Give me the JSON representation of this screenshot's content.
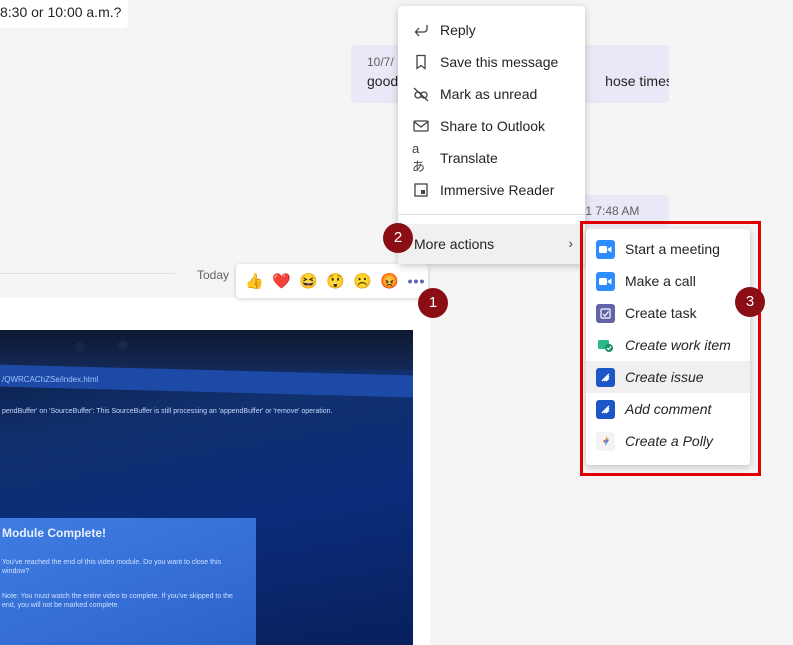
{
  "chat": {
    "prev_message_text": "8:30 or 10:00 a.m.?",
    "own_message": {
      "timestamp": "10/7/",
      "text": "good",
      "text_tail": "hose times."
    },
    "own_message2_timestamp": "021 7:48 AM",
    "today_label": "Today"
  },
  "image": {
    "url_text": "/QWRCAChZSe/index.html",
    "error_text": "pendBuffer' on 'SourceBuffer': This SourceBuffer is still processing an 'appendBuffer' or 'remove' operation.",
    "dialog_title": "Module Complete!",
    "dialog_body": "You've reached the end of this video module. Do you want to close this window?",
    "dialog_note": "Note: You must watch the entire video to complete. If you've skipped to the end, you will not be marked complete."
  },
  "reactions": [
    {
      "name": "like",
      "glyph": "👍"
    },
    {
      "name": "heart",
      "glyph": "❤️"
    },
    {
      "name": "laugh",
      "glyph": "😆"
    },
    {
      "name": "surprised",
      "glyph": "😲"
    },
    {
      "name": "sad",
      "glyph": "☹️"
    },
    {
      "name": "angry",
      "glyph": "😡"
    }
  ],
  "reaction_more": "•••",
  "context_menu": {
    "items": [
      {
        "label": "Reply",
        "icon": "reply-icon"
      },
      {
        "label": "Save this message",
        "icon": "bookmark-icon"
      },
      {
        "label": "Mark as unread",
        "icon": "mark-unread-icon"
      },
      {
        "label": "Share to Outlook",
        "icon": "mail-icon"
      },
      {
        "label": "Translate",
        "icon": "translate-icon",
        "glyph": "aあ"
      },
      {
        "label": "Immersive Reader",
        "icon": "immersive-reader-icon"
      }
    ],
    "more_actions": "More actions",
    "chevron": "›"
  },
  "sub_menu": {
    "items": [
      {
        "label": "Start a meeting",
        "icon": "zoom-icon",
        "color": "#2d8cff",
        "italic": false
      },
      {
        "label": "Make a call",
        "icon": "zoom-icon",
        "color": "#2d8cff",
        "italic": false
      },
      {
        "label": "Create task",
        "icon": "planner-icon",
        "color": "#6264a7",
        "italic": false
      },
      {
        "label": "Create work item",
        "icon": "work-item-icon",
        "color": "#2db88b",
        "italic": true
      },
      {
        "label": "Create issue",
        "icon": "jira-icon",
        "color": "#1d57c6",
        "italic": true
      },
      {
        "label": "Add comment",
        "icon": "jira-icon",
        "color": "#1d57c6",
        "italic": true
      },
      {
        "label": "Create a Polly",
        "icon": "polly-icon",
        "color": "#f4b400",
        "italic": true
      }
    ]
  },
  "badges": [
    "1",
    "2",
    "3"
  ],
  "colors": {
    "highlight_outline": "#e00000",
    "badge": "#8b0e14",
    "accent": "#5b5fc7"
  }
}
